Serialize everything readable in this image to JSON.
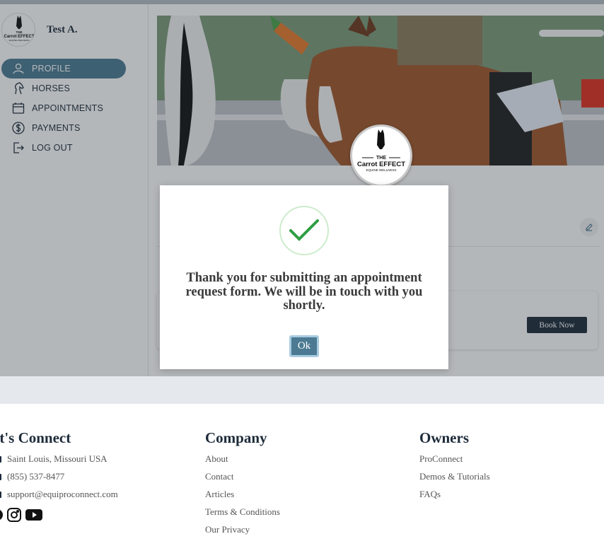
{
  "user": {
    "name": "Test A."
  },
  "brand": {
    "line1": "THE",
    "line2": "Carrot EFFECT",
    "line3": "EQUINE WELLNESS"
  },
  "nav": {
    "items": [
      {
        "label": "PROFILE",
        "icon": "user-icon",
        "active": true
      },
      {
        "label": "HORSES",
        "icon": "horse-icon",
        "active": false
      },
      {
        "label": "APPOINTMENTS",
        "icon": "calendar-icon",
        "active": false
      },
      {
        "label": "PAYMENTS",
        "icon": "dollar-icon",
        "active": false
      },
      {
        "label": "LOG OUT",
        "icon": "logout-icon",
        "active": false
      }
    ]
  },
  "main": {
    "book_now": "Book Now",
    "edit_icon": "pencil-icon"
  },
  "modal": {
    "icon": "check-icon",
    "message": "Thank you for submitting an appointment request form. We will be in touch with you shortly.",
    "ok_label": "Ok"
  },
  "footer": {
    "connect": {
      "title": "et's Connect",
      "address": "Saint Louis, Missouri USA",
      "phone": "(855) 537-8477",
      "email": "support@equiproconnect.com",
      "social": [
        "facebook-icon",
        "instagram-icon",
        "youtube-icon"
      ]
    },
    "company": {
      "title": "Company",
      "links": [
        "About",
        "Contact",
        "Articles",
        "Terms & Conditions",
        "Our Privacy"
      ]
    },
    "owners": {
      "title": "Owners",
      "links": [
        "ProConnect",
        "Demos & Tutorials",
        "FAQs"
      ]
    }
  },
  "colors": {
    "accent": "#4b7a92",
    "navy": "#1d2b3a",
    "success": "#2e9e44"
  }
}
